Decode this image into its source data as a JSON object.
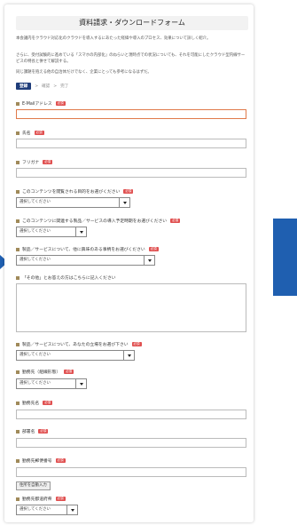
{
  "form": {
    "title": "資料請求・ダウンロードフォーム",
    "intro1": "本会議内をクラウド対応化のクラウドを導入するにあたった経緯や導入のプロセス、効果について詳しく紹介。",
    "intro2": "さらに、受付試験的に進めている「スマホの内部化」のねらいと現時点での状況についても、それを可能にしたクラウド型内線サービスの特長と併せて解説する。",
    "intro3": "同じ課題を抱える他の自治体だけでなく、企業にとっても参考になるはずだ。",
    "steps": [
      "登録",
      "確認",
      "完了"
    ],
    "step_sep": ">",
    "required_badge": "必須",
    "select_placeholder": "選択してください",
    "fields": {
      "email": "E-Mailアドレス",
      "name": "氏名",
      "furigana": "フリガナ",
      "purpose": "このコンテンツを閲覧される目的をお選びください",
      "timing": "このコンテンツに関連する製品／サービスの導入予定時期をお選びください",
      "interest": "製品／サービスについて、他に興味のある事柄をお選びください",
      "other": "「その他」とお答えの方はこちらに記入ください",
      "role": "製品／サービスについて、あなたの立場をお選び下さい",
      "company_type": "勤務先（組織形態）",
      "company_name": "勤務先名",
      "department": "部署名",
      "zip": "勤務先郵便番号",
      "prefecture": "勤務先都道府県"
    },
    "zip_button": "住所を自動入力"
  }
}
